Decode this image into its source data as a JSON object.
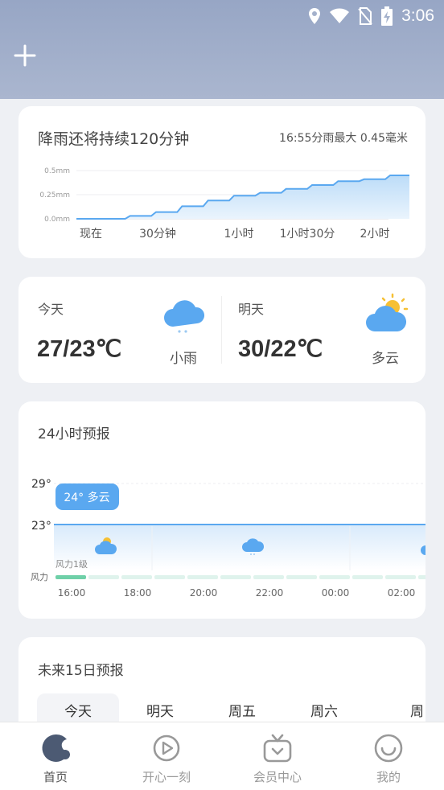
{
  "status_bar": {
    "time": "3:06"
  },
  "rain": {
    "title": "降雨还将持续120分钟",
    "subtitle": "16:55分雨最大 0.45毫米",
    "y_ticks": [
      "0.5mm",
      "0.25mm",
      "0.0mm"
    ],
    "x_labels": [
      "现在",
      "30分钟",
      "1小时",
      "1小时30分",
      "2小时"
    ]
  },
  "chart_data": {
    "type": "area",
    "title": "降雨还将持续120分钟",
    "x": [
      "现在",
      "30分钟",
      "1小时",
      "1小时30分",
      "2小时"
    ],
    "x_minutes": [
      0,
      10,
      20,
      30,
      40,
      50,
      60,
      70,
      80,
      90,
      100,
      110,
      120
    ],
    "values": [
      0.0,
      0.0,
      0.03,
      0.07,
      0.13,
      0.19,
      0.24,
      0.27,
      0.31,
      0.35,
      0.39,
      0.41,
      0.45
    ],
    "ylim": [
      0,
      0.5
    ],
    "ylabel": "mm"
  },
  "days": {
    "today": {
      "label": "今天",
      "temp": "27/23℃",
      "cond": "小雨",
      "icon": "rain-cloud-icon"
    },
    "tomorrow": {
      "label": "明天",
      "temp": "30/22℃",
      "cond": "多云",
      "icon": "partly-cloudy-icon"
    }
  },
  "hourly": {
    "title": "24小时预报",
    "temp_high": "29°",
    "temp_low": "23°",
    "bubble": "24° 多云",
    "wind_axis": "风力",
    "wind_label": "风力1级",
    "times": [
      "16:00",
      "18:00",
      "20:00",
      "22:00",
      "00:00",
      "02:00"
    ]
  },
  "forecast15": {
    "title": "未来15日预报",
    "tabs": [
      "今天",
      "明天",
      "周五",
      "周六",
      "周"
    ]
  },
  "tabbar": {
    "items": [
      {
        "label": "首页",
        "icon": "home-icon"
      },
      {
        "label": "开心一刻",
        "icon": "video-icon"
      },
      {
        "label": "会员中心",
        "icon": "tv-icon"
      },
      {
        "label": "我的",
        "icon": "smile-icon"
      }
    ]
  },
  "colors": {
    "accent": "#5aa8f0",
    "wind": "#6fd0a8"
  }
}
